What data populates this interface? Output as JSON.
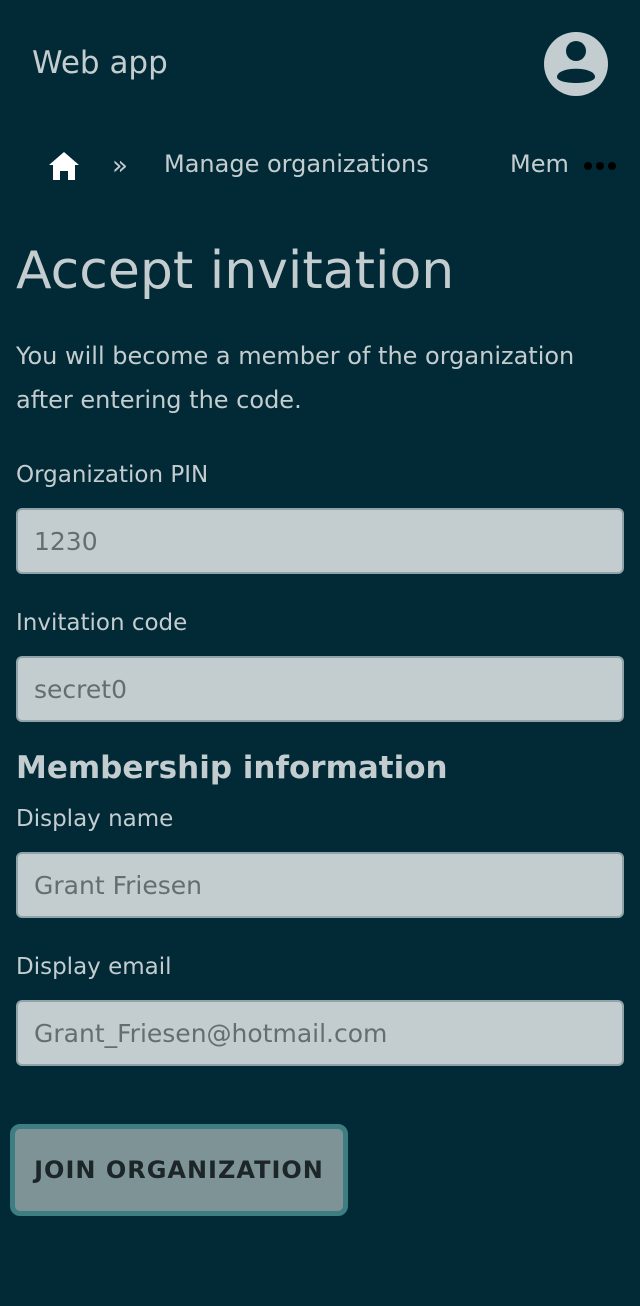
{
  "app": {
    "title": "Web app"
  },
  "header": {
    "avatar_icon": "user-circle-icon"
  },
  "breadcrumb": {
    "home_icon": "home-icon",
    "separator": "»",
    "items": [
      {
        "label": "Manage organizations"
      },
      {
        "label": "Mem"
      }
    ],
    "more_icon": "more-horizontal-icon"
  },
  "page": {
    "title": "Accept invitation",
    "description": "You will become a member of the organization after entering the code."
  },
  "form": {
    "pin": {
      "label": "Organization PIN",
      "placeholder": "1230"
    },
    "code": {
      "label": "Invitation code",
      "placeholder": "secret0"
    },
    "membership_heading": "Membership information",
    "display_name": {
      "label": "Display name",
      "placeholder": "Grant Friesen"
    },
    "display_email": {
      "label": "Display email",
      "placeholder": "Grant_Friesen@hotmail.com"
    },
    "submit_label": "JOIN ORGANIZATION"
  },
  "colors": {
    "background": "#022936",
    "text": "#c3cdcf",
    "field_background": "#c3cdcf",
    "button_background": "#7e9396",
    "button_border": "#3d7e83"
  }
}
